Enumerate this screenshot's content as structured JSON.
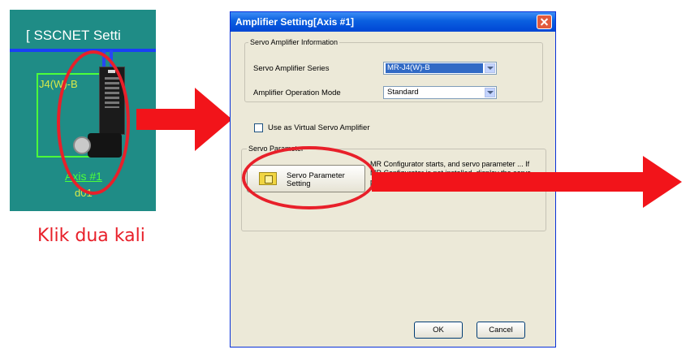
{
  "schematic": {
    "title": "[ SSCNET Setti",
    "amplifier_label": "J4(W)-B",
    "axis_name": "Axis #1",
    "axis_id": "d01"
  },
  "caption": "Klik dua kali",
  "dialog": {
    "title": "Amplifier Setting[Axis #1]",
    "info_group_label": "Servo Amplifier Information",
    "series_label": "Servo Amplifier Series",
    "series_value": "MR-J4(W)-B",
    "mode_label": "Amplifier Operation Mode",
    "mode_value": "Standard",
    "virtual_checkbox_label": "Use as Virtual Servo Amplifier",
    "param_group_label": "Servo Parameter",
    "param_button_label": "Servo Parameter\nSetting",
    "param_description": "MR Configurator starts, and servo parameter ... If MR Configurator is not installed, display the servo parameter setting screen.",
    "ok_label": "OK",
    "cancel_label": "Cancel"
  },
  "colors": {
    "highlight": "#e8202a",
    "schematic_bg": "#1f8c86",
    "titlebar": "#0a5fe0"
  }
}
